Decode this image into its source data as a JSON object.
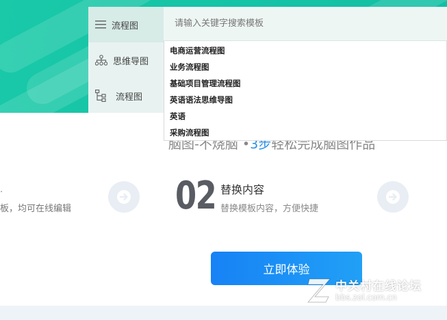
{
  "categories": [
    {
      "label": "流程图",
      "icon": "menu-icon",
      "active": true
    },
    {
      "label": "思维导图",
      "icon": "mindmap-icon",
      "active": false
    },
    {
      "label": "流程图",
      "icon": "flowchart-icon",
      "active": false
    }
  ],
  "search": {
    "placeholder": "请输入关键字搜索模板",
    "value": ""
  },
  "suggestions": [
    "电商运营流程图",
    "业务流程图",
    "基础项目管理流程图",
    "英语语法思维导图",
    "英语",
    "采购流程图"
  ],
  "tagline": {
    "part1": "脑图-不烧脑 •",
    "highlight": "3步",
    "part2": "轻松完成脑图作品"
  },
  "steps": {
    "left_partial_desc": "板，均可在线编辑",
    "left_partial_title": "·",
    "step2": {
      "number": "02",
      "title": "替换内容",
      "desc": "替换模板内容，方便快捷"
    }
  },
  "cta": {
    "label": "立即体验"
  },
  "watermark": {
    "title": "中关村在线论坛",
    "url": "bbs.zol.com.cn"
  },
  "colors": {
    "hero": "#16c4a6",
    "accent": "#1782f5",
    "highlight": "#2a8ee8"
  }
}
